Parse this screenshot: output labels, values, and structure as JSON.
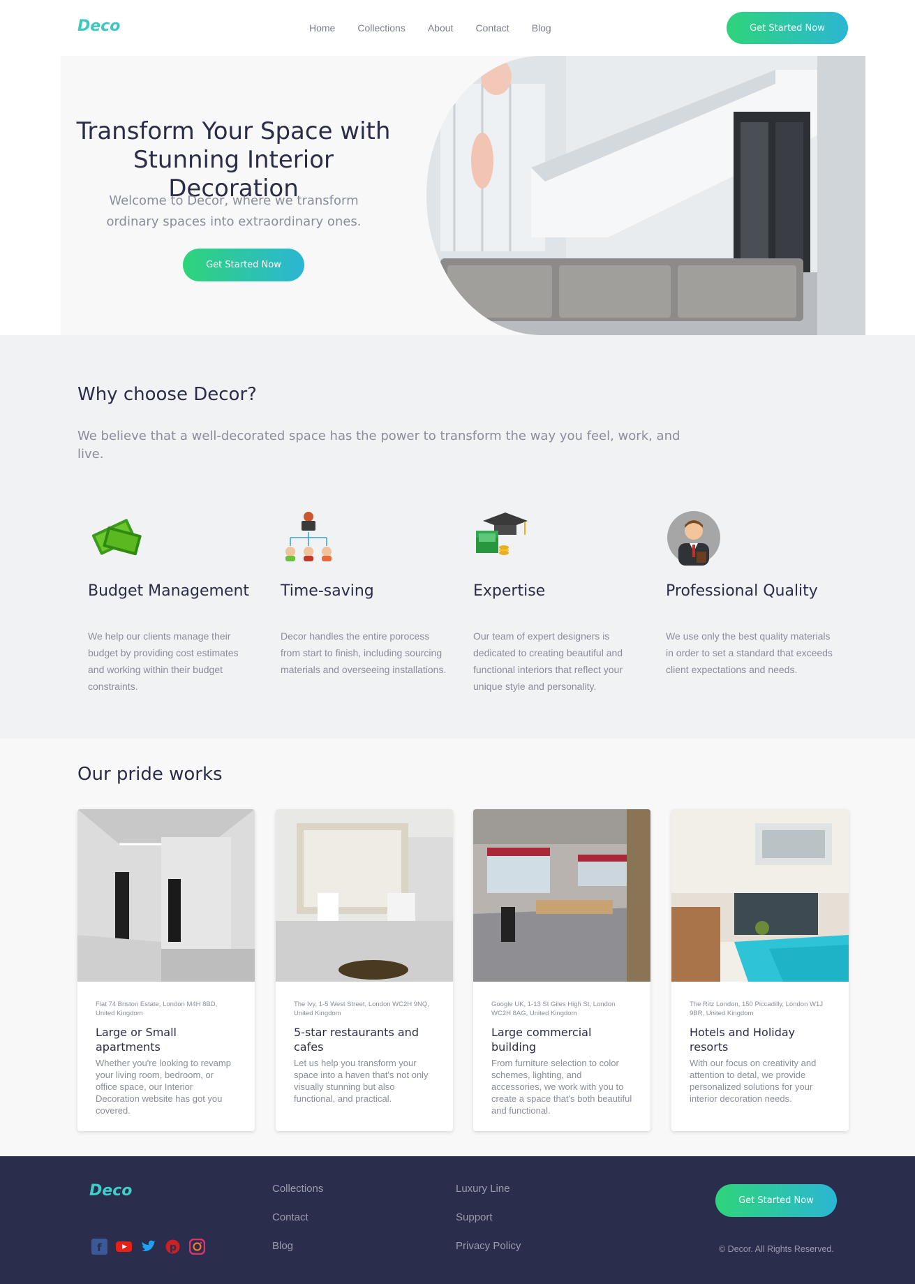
{
  "nav": {
    "logo_text": "Deco",
    "links": [
      "Home",
      "Collections",
      "About",
      "Contact",
      "Blog"
    ],
    "cta": "Get Started Now"
  },
  "hero": {
    "title": "Transform Your Space with Stunning Interior Decoration",
    "subtitle": "Welcome to Decor, where we transform ordinary spaces into extraordinary ones.",
    "cta": "Get Started Now"
  },
  "why": {
    "title": "Why choose Decor?",
    "subtitle": "We believe that a well-decorated space has the power to transform the way you feel, work, and live.",
    "features": [
      {
        "icon": "money-icon",
        "title": "Budget Management",
        "text": "We help our clients manage their budget by providing cost estimates and working within their budget constraints."
      },
      {
        "icon": "team-hierarchy-icon",
        "title": "Time-saving",
        "text": "Decor handles the entire porocess from start to finish, including sourcing materials and overseeing installations."
      },
      {
        "icon": "graduation-cap-icon",
        "title": "Expertise",
        "text": "Our team of expert designers is dedicated to creating beautiful and functional interiors that reflect your unique style and personality."
      },
      {
        "icon": "businessman-icon",
        "title": "Professional Quality",
        "text": "We use only the best quality materials in order to set a standard that exceeds client expectations and needs."
      }
    ]
  },
  "works": {
    "title": "Our pride works",
    "cards": [
      {
        "address": "Flat 74 Briston Estate, London M4H 8BD, United Kingdom",
        "title": "Large or Small apartments",
        "desc": "Whether you're looking to revamp your living room, bedroom, or office space, our Interior Decoration website has got you covered."
      },
      {
        "address": "The Ivy, 1-5 West Street, London WC2H 9NQ, United Kingdom",
        "title": "5-star restaurants and cafes",
        "desc": "Let us help you transform your space into a haven that's not only visually stunning but also functional, and practical."
      },
      {
        "address": "Google UK, 1-13 St Giles High St, London WC2H 8AG, United Kingdom",
        "title": "Large commercial building",
        "desc": "From furniture selection to color schemes, lighting, and accessories, we work with you to create a space that's both beautiful and functional."
      },
      {
        "address": "The Ritz London, 150 Piccadilly, London W1J 9BR, United Kingdom",
        "title": "Hotels and Holiday resorts",
        "desc": "With our focus on creativity and attention to detal, we provide personalized solutions for your interior decoration needs."
      }
    ]
  },
  "footer": {
    "col1": [
      "Collections",
      "Contact",
      "Blog"
    ],
    "col2": [
      "Luxury Line",
      "Support",
      "Privacy Policy"
    ],
    "cta": "Get Started Now",
    "copyright": "© Decor. All Rights Reserved.",
    "social": [
      "facebook-icon",
      "youtube-icon",
      "twitter-icon",
      "pinterest-icon",
      "instagram-icon"
    ]
  },
  "colors": {
    "accent_start": "#2ed47a",
    "accent_end": "#2bb6d4",
    "footer_bg": "#2a2d4c",
    "text_dark": "#2a2d48"
  }
}
